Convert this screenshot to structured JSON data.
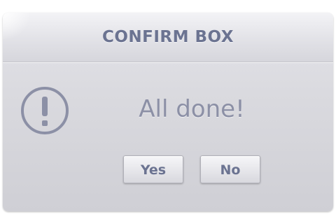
{
  "dialog": {
    "title": "CONFIRM BOX",
    "message": "All done!",
    "icon": "exclamation-circle-icon",
    "buttons": {
      "yes_label": "Yes",
      "no_label": "No"
    }
  },
  "colors": {
    "text": "#6b7391",
    "message": "#8c90a6",
    "icon": "#8c90a6",
    "panel": "#dadadf"
  }
}
